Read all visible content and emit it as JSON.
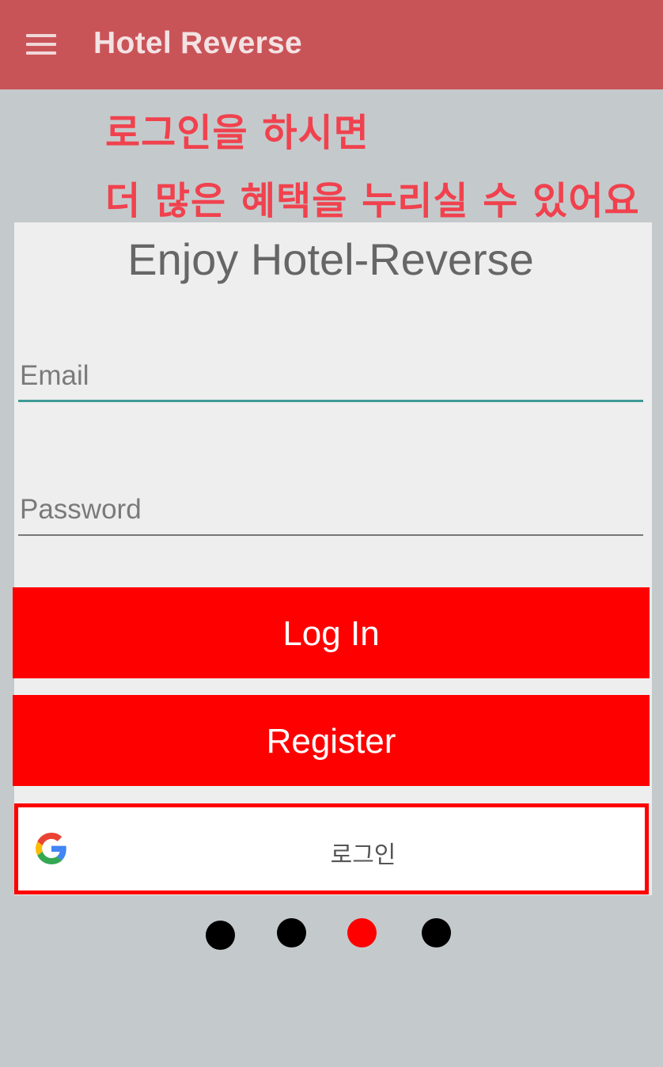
{
  "appbar": {
    "title": "Hotel Reverse",
    "menu_icon": "menu-icon",
    "color": "#c95458"
  },
  "promo": {
    "line1": "로그인을 하시면",
    "line2": "더 많은 혜택을 누리실 수 있어요",
    "color": "#f0424e"
  },
  "card": {
    "title": "Enjoy Hotel-Reverse",
    "email_placeholder": "Email",
    "email_value": "",
    "password_placeholder": "Password",
    "password_value": "",
    "login_label": "Log In",
    "register_label": "Register",
    "google_label": "로그인",
    "google_icon": "google-g-icon",
    "button_color": "#ff0000"
  },
  "pager": {
    "count": 4,
    "active_index": 2,
    "active_color": "#ff0000",
    "inactive_color": "#000000"
  }
}
